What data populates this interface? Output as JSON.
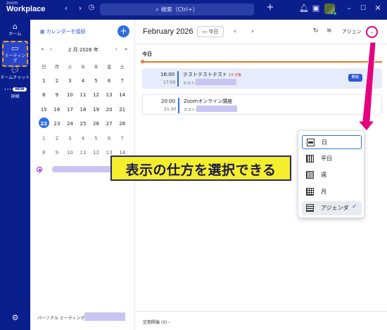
{
  "app": {
    "brand_small": "zoom",
    "brand_big": "Workplace"
  },
  "titlebar": {
    "search_icon": "search-icon",
    "search_text": "検索（Ctrl+）",
    "add": "+",
    "icons": [
      "back-icon",
      "forward-icon",
      "history-icon",
      "notification-icon",
      "whiteboard-icon",
      "minimize-icon",
      "maximize-icon",
      "close-icon"
    ]
  },
  "rail": {
    "home": "ホーム",
    "meetings": "ミーティング",
    "team_chat": "チームチャット",
    "new_badge": "NEW",
    "more": "詳細",
    "settings_icon": "gear-icon"
  },
  "calendar_panel": {
    "connect_label": "カレンダーを接続",
    "add_label": "+",
    "prev_year": "«",
    "prev_month": "‹",
    "next_month": "›",
    "next_year": "»",
    "title": "2 月 2026 年",
    "weekdays": [
      "日",
      "月",
      "火",
      "水",
      "木",
      "金",
      "土"
    ],
    "weeks": [
      [
        "1",
        "2",
        "3",
        "4",
        "5",
        "6",
        "7"
      ],
      [
        "8",
        "9",
        "10",
        "11",
        "12",
        "13",
        "14"
      ],
      [
        "15",
        "16",
        "17",
        "18",
        "19",
        "20",
        "21"
      ],
      [
        "22",
        "23",
        "24",
        "25",
        "26",
        "27",
        "28"
      ],
      [
        "1",
        "2",
        "3",
        "4",
        "5",
        "6",
        "7"
      ],
      [
        "8",
        "9",
        "10",
        "11",
        "12",
        "13",
        "14"
      ]
    ],
    "today": "22",
    "personal_meeting_id_label": "パーソナル ミーティング ID"
  },
  "main": {
    "month_title": "February 2026",
    "today_button": "今日",
    "prev": "‹",
    "next": "›",
    "view_label": "アジェン",
    "view_chevron": "⌄",
    "today_header": "今日",
    "events": [
      {
        "start": "16:00",
        "end": "17:00",
        "title": "テストテストテスト",
        "sub": "14 分後",
        "host": "ホスト:",
        "action": "開始"
      },
      {
        "start": "20:00",
        "end": "21:30",
        "title": "Zoomオンライン講座",
        "sub": "",
        "host": "ホスト:",
        "action": ""
      }
    ],
    "recurring": "定期開催 (9)  ›"
  },
  "view_menu": {
    "items": [
      {
        "label": "日",
        "icon": "day-view-icon"
      },
      {
        "label": "平日",
        "icon": "workweek-view-icon"
      },
      {
        "label": "週",
        "icon": "week-view-icon"
      },
      {
        "label": "月",
        "icon": "month-view-icon"
      },
      {
        "label": "アジェンダ",
        "icon": "agenda-view-icon",
        "checked": true
      }
    ],
    "check": "✓"
  },
  "annotation": {
    "text": "表示の仕方を選択できる",
    "color": "#f5ee2c",
    "arrow_color": "#e5007f"
  },
  "colors": {
    "brand": "#0b1f8c",
    "accent": "#2f6fe0",
    "now_line": "#e9772d"
  }
}
